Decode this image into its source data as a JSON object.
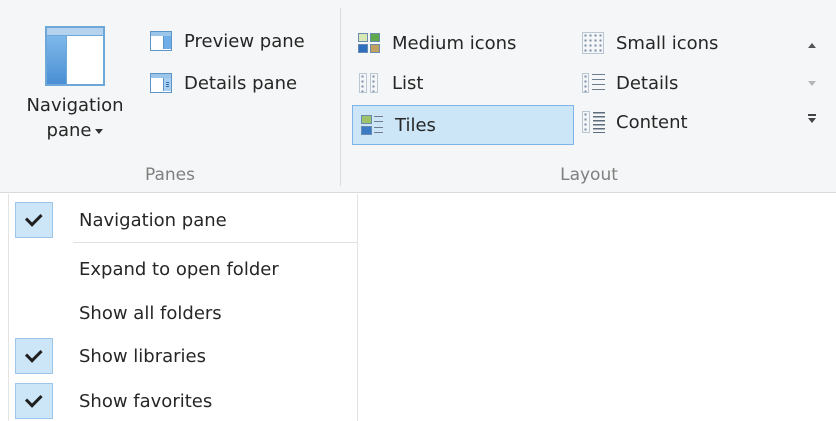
{
  "ribbon": {
    "panes_group": {
      "label": "Panes",
      "navigation_pane_line1": "Navigation",
      "navigation_pane_line2": "pane",
      "preview_pane": "Preview pane",
      "details_pane": "Details pane"
    },
    "layout_group": {
      "label": "Layout",
      "medium_icons": "Medium icons",
      "small_icons": "Small icons",
      "list": "List",
      "details": "Details",
      "tiles": "Tiles",
      "content": "Content",
      "selected": "Tiles"
    }
  },
  "menu": {
    "items": [
      {
        "label": "Navigation pane",
        "checked": true
      },
      {
        "label": "Expand to open folder",
        "checked": false
      },
      {
        "label": "Show all folders",
        "checked": false
      },
      {
        "label": "Show libraries",
        "checked": true
      },
      {
        "label": "Show favorites",
        "checked": true
      }
    ]
  },
  "colors": {
    "selection_fill": "#cde6f7",
    "selection_border": "#7eb4ea",
    "ribbon_background": "#f5f6f7",
    "group_label": "#7f7f7f"
  }
}
